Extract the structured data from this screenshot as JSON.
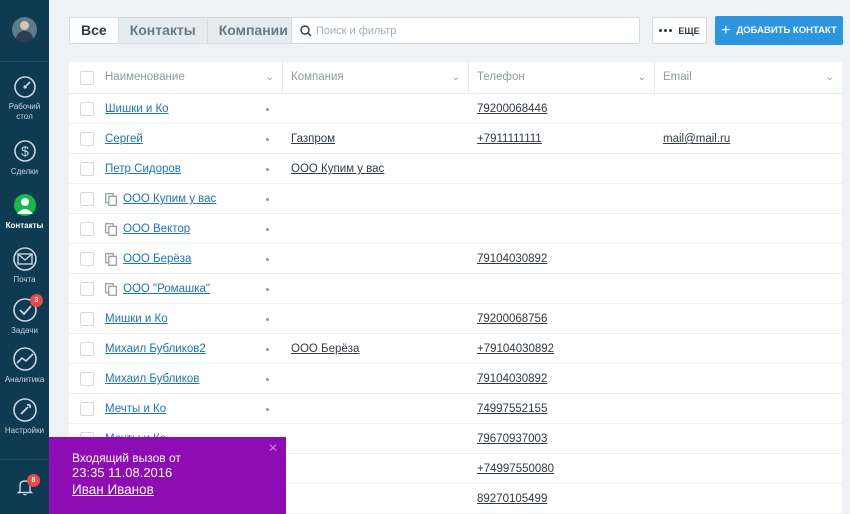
{
  "sidebar": {
    "items": [
      {
        "label_line1": "Рабочий",
        "label_line2": "стол",
        "icon": "dashboard-icon"
      },
      {
        "label_line1": "Сделки",
        "label_line2": "",
        "icon": "dollar-icon"
      },
      {
        "label_line1": "Контакты",
        "label_line2": "",
        "icon": "contacts-icon"
      },
      {
        "label_line1": "Почта",
        "label_line2": "",
        "icon": "mail-icon"
      },
      {
        "label_line1": "Задачи",
        "label_line2": "",
        "icon": "tasks-icon",
        "badge": "3"
      },
      {
        "label_line1": "Аналитика",
        "label_line2": "",
        "icon": "analytics-icon"
      },
      {
        "label_line1": "Настройки",
        "label_line2": "",
        "icon": "settings-icon"
      }
    ],
    "notifications_badge": "8",
    "colors": {
      "background": "#0e3a52",
      "active_icon": "#19b84a",
      "badge": "#e84b4b"
    }
  },
  "toolbar": {
    "tabs": [
      "Все",
      "Контакты",
      "Компании"
    ],
    "active_tab": "Все",
    "search_placeholder": "Поиск и фильтр",
    "search_value": "",
    "more_label": "ЕЩЕ",
    "add_label": "ДОБАВИТЬ КОНТАКТ",
    "colors": {
      "add_button": "#2b95e0"
    }
  },
  "table": {
    "columns": [
      "Наименование",
      "Компания",
      "Телефон",
      "Email"
    ],
    "rows": [
      {
        "name": "Шишки и Ко",
        "company": "",
        "phone": "79200068446",
        "email": "",
        "is_company": false
      },
      {
        "name": "Сергей",
        "company": "Газпром",
        "phone": "+7911111111",
        "email": "mail@mail.ru",
        "is_company": false
      },
      {
        "name": "Петр Сидоров",
        "company": "ООО Купим у вас",
        "phone": "",
        "email": "",
        "is_company": false
      },
      {
        "name": "ООО Купим у вас",
        "company": "",
        "phone": "",
        "email": "",
        "is_company": true
      },
      {
        "name": "ООО Вектор",
        "company": "",
        "phone": "",
        "email": "",
        "is_company": true
      },
      {
        "name": "ООО Берёза",
        "company": "",
        "phone": "79104030892",
        "email": "",
        "is_company": true
      },
      {
        "name": "ООО \"Ромашка\"",
        "company": "",
        "phone": "",
        "email": "",
        "is_company": true
      },
      {
        "name": "Мишки и Ко",
        "company": "",
        "phone": "79200068756",
        "email": "",
        "is_company": false
      },
      {
        "name": "Михаил Бубликов2",
        "company": "ООО Берёза",
        "phone": "+79104030892",
        "email": "",
        "is_company": false
      },
      {
        "name": "Михаил Бубликов",
        "company": "",
        "phone": "79104030892",
        "email": "",
        "is_company": false
      },
      {
        "name": "Мечты и Ко",
        "company": "",
        "phone": "74997552155",
        "email": "",
        "is_company": false
      },
      {
        "name": "Мечты и Ко",
        "company": "",
        "phone": "79670937003",
        "email": "",
        "is_company": false
      },
      {
        "name": "",
        "company": "",
        "phone": "+74997550080",
        "email": "",
        "is_company": false
      },
      {
        "name": "",
        "company": "",
        "phone": "89270105499",
        "email": "",
        "is_company": false
      }
    ],
    "colors": {
      "link": "#1b73c2",
      "text": "#313942"
    }
  },
  "call_notification": {
    "title": "Входящий вызов от",
    "datetime": "23:35 11.08.2016",
    "caller": "Иван Иванов",
    "close_symbol": "✕",
    "colors": {
      "background": "#8e0cb3"
    }
  }
}
